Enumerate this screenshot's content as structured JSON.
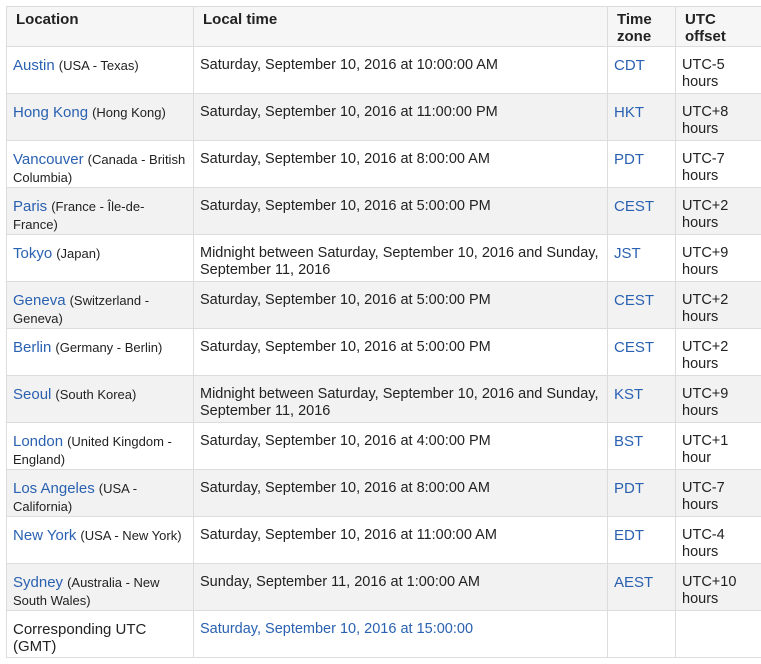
{
  "headers": [
    "Location",
    "Local time",
    "Time zone",
    "UTC offset"
  ],
  "rows": [
    {
      "city": "Austin",
      "region": "(USA - Texas)",
      "time": "Saturday, September 10, 2016 at 10:00:00 AM",
      "tz": "CDT",
      "offset": "UTC-5 hours"
    },
    {
      "city": "Hong Kong",
      "region": "(Hong Kong)",
      "time": "Saturday, September 10, 2016 at 11:00:00 PM",
      "tz": "HKT",
      "offset": "UTC+8 hours"
    },
    {
      "city": "Vancouver",
      "region": "(Canada - British Columbia)",
      "time": "Saturday, September 10, 2016 at 8:00:00 AM",
      "tz": "PDT",
      "offset": "UTC-7 hours"
    },
    {
      "city": "Paris",
      "region": "(France - Île-de-France)",
      "time": "Saturday, September 10, 2016 at 5:00:00 PM",
      "tz": "CEST",
      "offset": "UTC+2 hours"
    },
    {
      "city": "Tokyo",
      "region": "(Japan)",
      "time": "Midnight between Saturday, September 10, 2016 and Sunday, September 11, 2016",
      "tz": "JST",
      "offset": "UTC+9 hours"
    },
    {
      "city": "Geneva",
      "region": "(Switzerland - Geneva)",
      "time": "Saturday, September 10, 2016 at 5:00:00 PM",
      "tz": "CEST",
      "offset": "UTC+2 hours"
    },
    {
      "city": "Berlin",
      "region": "(Germany - Berlin)",
      "time": "Saturday, September 10, 2016 at 5:00:00 PM",
      "tz": "CEST",
      "offset": "UTC+2 hours"
    },
    {
      "city": "Seoul",
      "region": "(South Korea)",
      "time": "Midnight between Saturday, September 10, 2016 and Sunday, September 11, 2016",
      "tz": "KST",
      "offset": "UTC+9 hours"
    },
    {
      "city": "London",
      "region": "(United Kingdom - England)",
      "time": "Saturday, September 10, 2016 at 4:00:00 PM",
      "tz": "BST",
      "offset": "UTC+1 hour"
    },
    {
      "city": "Los Angeles",
      "region": "(USA - California)",
      "time": "Saturday, September 10, 2016 at 8:00:00 AM",
      "tz": "PDT",
      "offset": "UTC-7 hours"
    },
    {
      "city": "New York",
      "region": "(USA - New York)",
      "time": "Saturday, September 10, 2016 at 11:00:00 AM",
      "tz": "EDT",
      "offset": "UTC-4 hours"
    },
    {
      "city": "Sydney",
      "region": "(Australia - New South Wales)",
      "time": "Sunday, September 11, 2016 at 1:00:00 AM",
      "tz": "AEST",
      "offset": "UTC+10 hours"
    }
  ],
  "utc_row": {
    "label": "Corresponding UTC (GMT)",
    "time": "Saturday, September 10, 2016 at 15:00:00"
  },
  "colors": {
    "link": "#2a61b1",
    "header_bg": "#f6f6f6",
    "alt_row_bg": "#f2f2f2",
    "border": "#dcdcdc"
  }
}
